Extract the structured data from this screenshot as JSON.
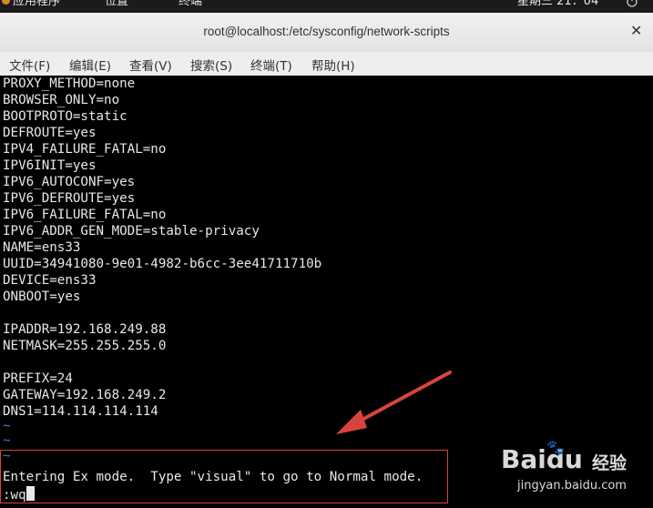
{
  "topbar": {
    "applications": "应用程序",
    "places": "位置",
    "terminal": "终端",
    "clock": "星期三 21：04",
    "power_icon": "power-icon"
  },
  "window": {
    "title": "root@localhost:/etc/sysconfig/network-scripts",
    "close_icon": "close-icon"
  },
  "menubar": {
    "file": "文件(F)",
    "edit": "编辑(E)",
    "view": "查看(V)",
    "search": "搜索(S)",
    "terminal": "终端(T)",
    "help": "帮助(H)"
  },
  "terminal": {
    "lines": [
      "PROXY_METHOD=none",
      "BROWSER_ONLY=no",
      "BOOTPROTO=static",
      "DEFROUTE=yes",
      "IPV4_FAILURE_FATAL=no",
      "IPV6INIT=yes",
      "IPV6_AUTOCONF=yes",
      "IPV6_DEFROUTE=yes",
      "IPV6_FAILURE_FATAL=no",
      "IPV6_ADDR_GEN_MODE=stable-privacy",
      "NAME=ens33",
      "UUID=34941080-9e01-4982-b6cc-3ee41711710b",
      "DEVICE=ens33",
      "ONBOOT=yes",
      "",
      "IPADDR=192.168.249.88",
      "NETMASK=255.255.255.0",
      "",
      "PREFIX=24",
      "GATEWAY=192.168.249.2",
      "DNS1=114.114.114.114"
    ],
    "tildes": [
      "~",
      "~",
      "~"
    ],
    "ex_message": "Entering Ex mode.  Type \"visual\" to go to Normal mode.",
    "command": ":wq"
  },
  "watermark": {
    "brand": "Bai",
    "brand_du": "du",
    "word": "经验",
    "url": "jingyan.baidu.com"
  },
  "colors": {
    "annotation": "#d9443a",
    "tilde": "#3f7fd6"
  }
}
